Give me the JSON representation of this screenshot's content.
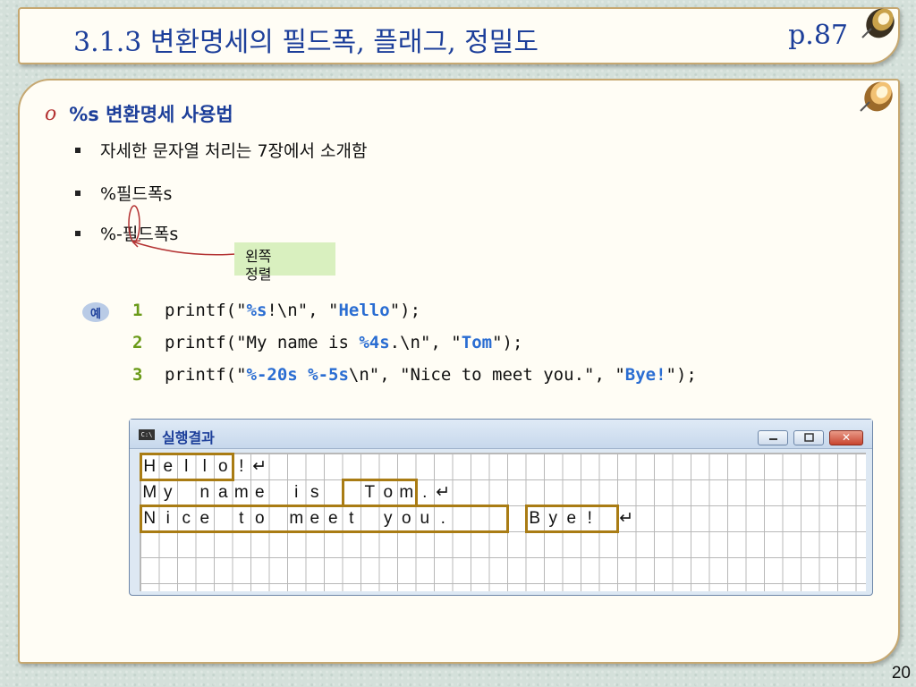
{
  "title": {
    "text": "3.1.3 변환명세의 필드폭, 플래그, 정밀도",
    "page": "p.87"
  },
  "heading": {
    "marker": "o",
    "text": "%s 변환명세 사용법"
  },
  "bullets": [
    "자세한 문자열 처리는 7장에서 소개함",
    "%필드폭s",
    "%-필드폭s"
  ],
  "callout": {
    "line1": "왼쪽",
    "line2": "정렬"
  },
  "example": {
    "badge": "예",
    "lines": [
      {
        "num": "1",
        "parts": [
          {
            "t": "printf(\""
          },
          {
            "t": "%s",
            "hl": true
          },
          {
            "t": "!\\n\", \""
          },
          {
            "t": "Hello",
            "hl": true
          },
          {
            "t": "\");"
          }
        ]
      },
      {
        "num": "2",
        "parts": [
          {
            "t": "printf(\"My name is "
          },
          {
            "t": "%4s",
            "hl": true
          },
          {
            "t": ".\\n\", \""
          },
          {
            "t": "Tom",
            "hl": true
          },
          {
            "t": "\");"
          }
        ]
      },
      {
        "num": "3",
        "parts": [
          {
            "t": "printf(\""
          },
          {
            "t": "%-20s %-5s",
            "hl": true
          },
          {
            "t": "\\n\", \"Nice to meet you.\", \""
          },
          {
            "t": "Bye!",
            "hl": true
          },
          {
            "t": "\");"
          }
        ]
      }
    ]
  },
  "output_window": {
    "title": "실행결과",
    "icon_text": "C:\\",
    "rows": [
      [
        "H",
        "e",
        "l",
        "l",
        "o",
        "!",
        "↵"
      ],
      [
        "M",
        "y",
        "",
        "n",
        "a",
        "m",
        "e",
        "",
        "i",
        "s",
        "",
        "",
        "T",
        "o",
        "m",
        ".",
        "↵"
      ],
      [
        "N",
        "i",
        "c",
        "e",
        "",
        "t",
        "o",
        "",
        "m",
        "e",
        "e",
        "t",
        "",
        "y",
        "o",
        "u",
        ".",
        "",
        "",
        "",
        "",
        "B",
        "y",
        "e",
        "!",
        "",
        "↵"
      ]
    ]
  },
  "slide_number": "20"
}
